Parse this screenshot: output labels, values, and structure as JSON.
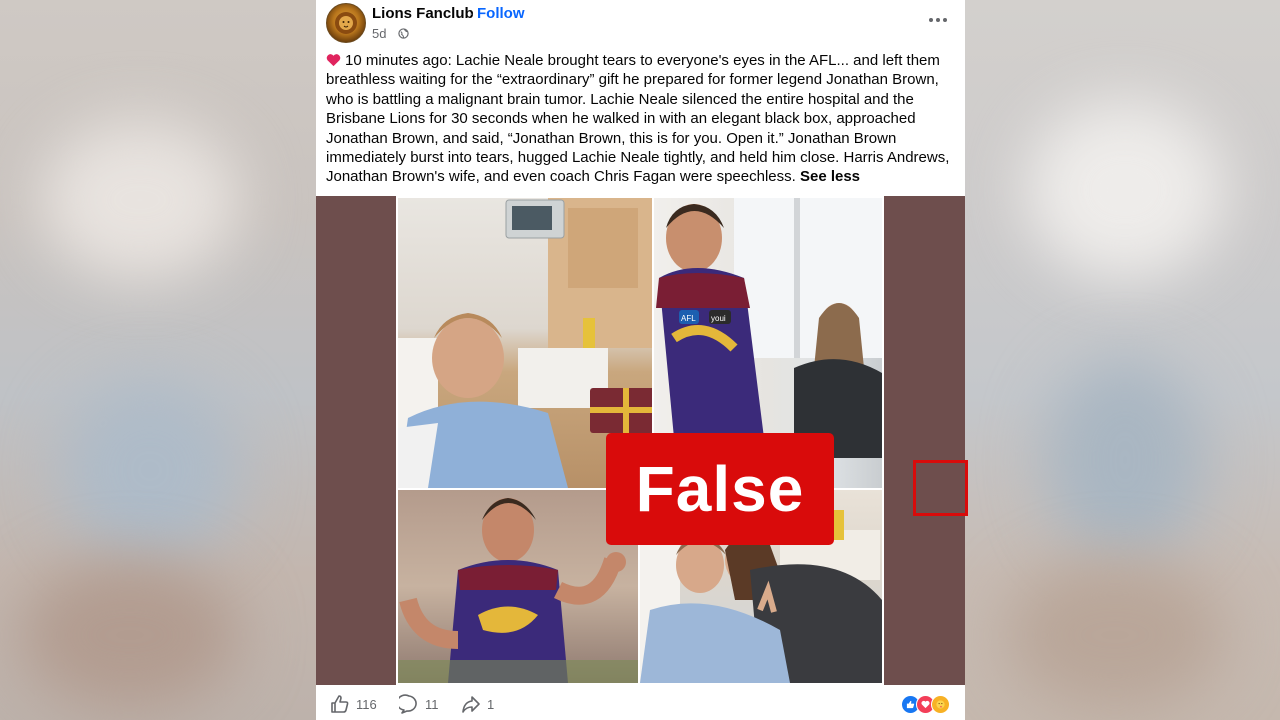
{
  "post": {
    "page_name": "Lions Fanclub",
    "separator": "·",
    "follow_label": "Follow",
    "time": "5d",
    "audience_icon": "globe-icon",
    "caption": "10 minutes ago: Lachie Neale brought tears to everyone's eyes in the AFL... and left them breathless waiting for the “extraordinary” gift he prepared for former legend Jonathan Brown, who is battling a malignant brain tumor. Lachie Neale silenced the entire hospital and the Brisbane Lions for 30 seconds when he walked in with an elegant black box, approached Jonathan Brown, and said, “Jonathan Brown, this is for you. Open it.” Jonathan Brown immediately burst into tears, hugged Lachie Neale tightly, and held him close. Harris Andrews, Jonathan Brown's wife, and even coach Chris Fagan were speechless.",
    "see_less": "See less"
  },
  "media": {
    "badge_label": "False",
    "badge_color": "#d90b0b",
    "image_text": {
      "logo_afl": "AFL",
      "logo_youi": "youi"
    }
  },
  "footer": {
    "likes": "116",
    "comments": "11",
    "shares": "1",
    "reaction_icons": [
      "like-reaction-icon",
      "love-reaction-icon",
      "care-reaction-icon"
    ]
  },
  "colors": {
    "accent": "#0866ff",
    "text": "#050505",
    "secondary_text": "#65676b",
    "media_background": "#6e4e4d"
  }
}
